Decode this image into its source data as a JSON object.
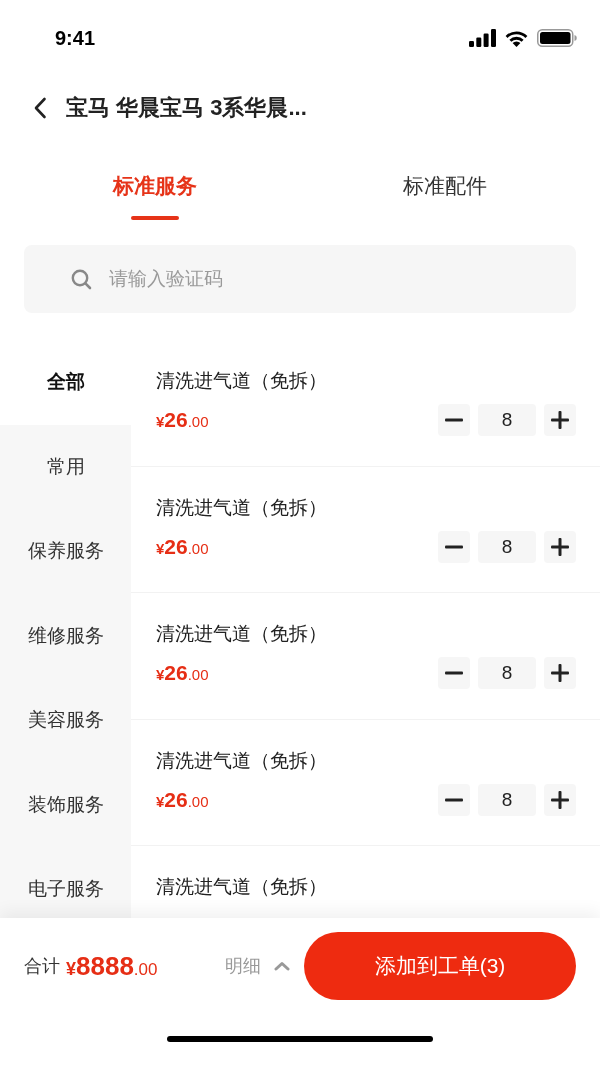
{
  "status_bar": {
    "time": "9:41"
  },
  "header": {
    "title": "宝马 华晨宝马 3系华晨..."
  },
  "tabs": [
    {
      "label": "标准服务",
      "selected": true
    },
    {
      "label": "标准配件",
      "selected": false
    }
  ],
  "search": {
    "placeholder": "请输入验证码"
  },
  "categories": [
    {
      "label": "全部",
      "selected": true
    },
    {
      "label": "常用",
      "selected": false
    },
    {
      "label": "保养服务",
      "selected": false
    },
    {
      "label": "维修服务",
      "selected": false
    },
    {
      "label": "美容服务",
      "selected": false
    },
    {
      "label": "装饰服务",
      "selected": false
    },
    {
      "label": "电子服务",
      "selected": false
    }
  ],
  "services": [
    {
      "name": "清洗进气道（免拆）",
      "price": {
        "currency": "¥",
        "amount": "26",
        "cents": ".00"
      },
      "quantity": "8"
    },
    {
      "name": "清洗进气道（免拆）",
      "price": {
        "currency": "¥",
        "amount": "26",
        "cents": ".00"
      },
      "quantity": "8"
    },
    {
      "name": "清洗进气道（免拆）",
      "price": {
        "currency": "¥",
        "amount": "26",
        "cents": ".00"
      },
      "quantity": "8"
    },
    {
      "name": "清洗进气道（免拆）",
      "price": {
        "currency": "¥",
        "amount": "26",
        "cents": ".00"
      },
      "quantity": "8"
    },
    {
      "name": "清洗进气道（免拆）"
    }
  ],
  "footer": {
    "total_label": "合计",
    "total": {
      "currency": "¥",
      "amount": "8888",
      "cents": ".00"
    },
    "details_label": "明细",
    "submit_label": "添加到工单(3)"
  }
}
